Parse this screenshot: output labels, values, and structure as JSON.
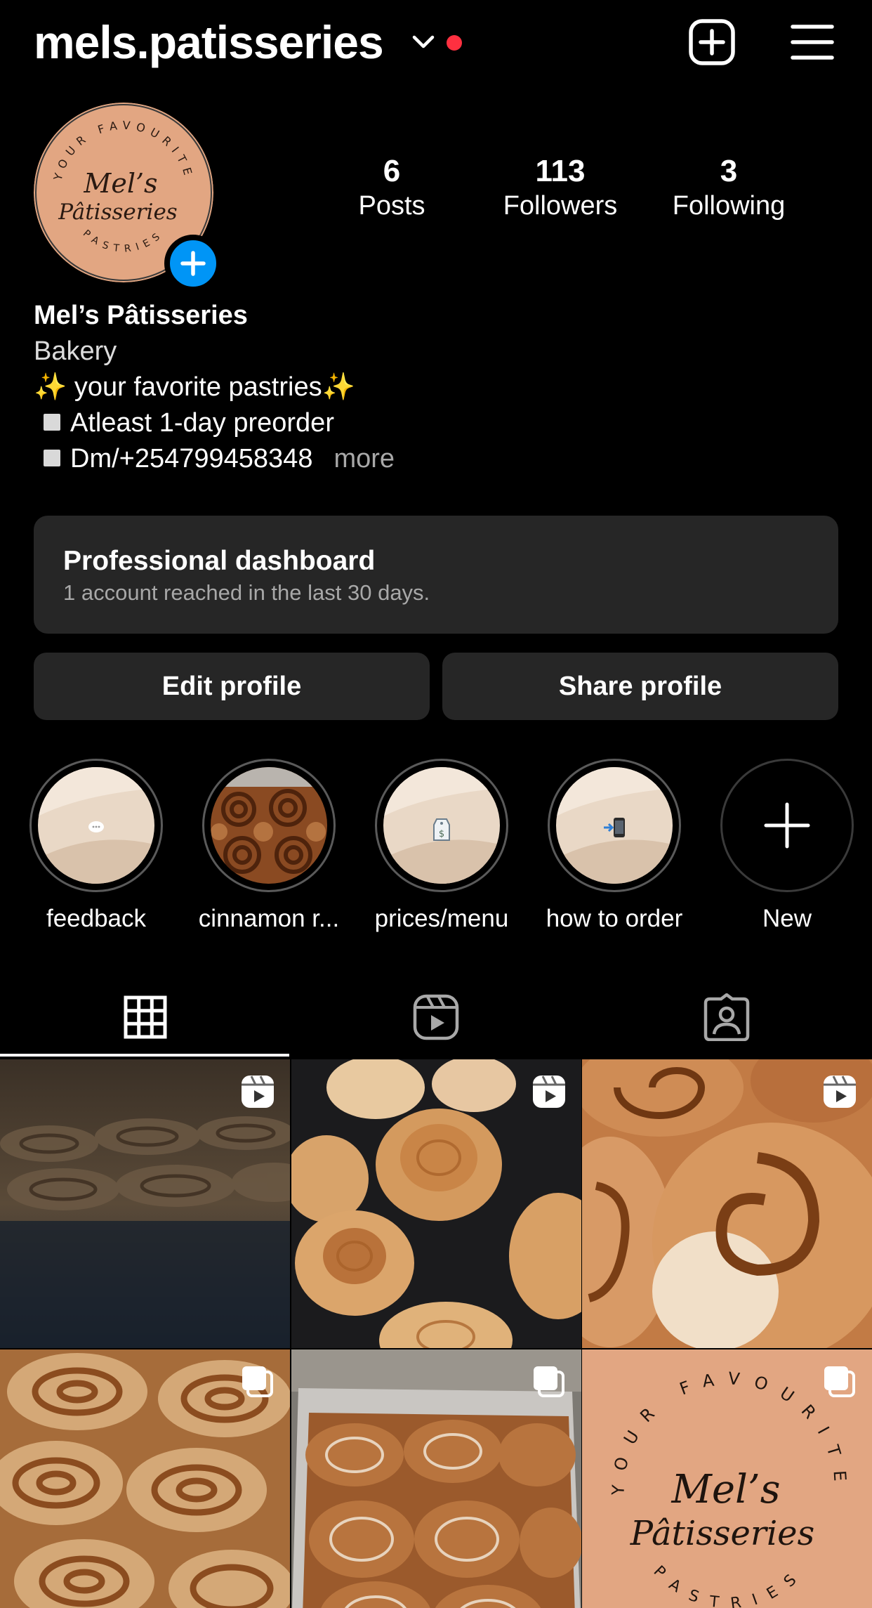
{
  "header": {
    "username": "mels.patisseries",
    "icons": [
      "chevron-down-icon",
      "notification-dot",
      "add-post-icon",
      "menu-icon"
    ],
    "notification_color": "#ff3040"
  },
  "avatar": {
    "ring_text_top": "YOUR FAVOURITE",
    "ring_text_bottom": "PASTRIES",
    "logo_line1": "Mel’s",
    "logo_line2": "Pâtisseries",
    "bg_color": "#e2a682"
  },
  "stats": [
    {
      "value": "6",
      "label": "Posts"
    },
    {
      "value": "113",
      "label": "Followers"
    },
    {
      "value": "3",
      "label": "Following"
    }
  ],
  "bio": {
    "name": "Mel’s Pâtisseries",
    "category": "Bakery",
    "line1": "✨ your favorite pastries✨",
    "line2": "Atleast 1-day preorder",
    "line3": "Dm/+254799458348",
    "more": "more"
  },
  "dashboard": {
    "title": "Professional dashboard",
    "subtitle": "1 account reached in the last 30 days."
  },
  "buttons": {
    "edit": "Edit profile",
    "share": "Share profile"
  },
  "highlights": [
    {
      "label": "feedback",
      "icon": "speech-bubble-icon"
    },
    {
      "label": "cinnamon r...",
      "icon": "cinnamon-rolls-photo"
    },
    {
      "label": "prices/menu",
      "icon": "price-tag-icon"
    },
    {
      "label": "how to order",
      "icon": "phone-icon"
    },
    {
      "label": "New",
      "icon": "plus-icon"
    }
  ],
  "tabs": [
    {
      "name": "posts",
      "icon": "grid-icon",
      "active": true
    },
    {
      "name": "reels",
      "icon": "reels-icon",
      "active": false
    },
    {
      "name": "tagged",
      "icon": "tagged-user-icon",
      "active": false
    }
  ],
  "posts": [
    {
      "type": "reel",
      "subject": "cinnamon rolls in oven"
    },
    {
      "type": "reel",
      "subject": "swirl buns"
    },
    {
      "type": "reel",
      "subject": "cinnamon roll close-up"
    },
    {
      "type": "carousel",
      "subject": "sugared cinnamon rolls"
    },
    {
      "type": "carousel",
      "subject": "glazed cinnamon rolls in tray"
    },
    {
      "type": "carousel",
      "subject": "Mel’s Pâtisseries logo"
    }
  ]
}
